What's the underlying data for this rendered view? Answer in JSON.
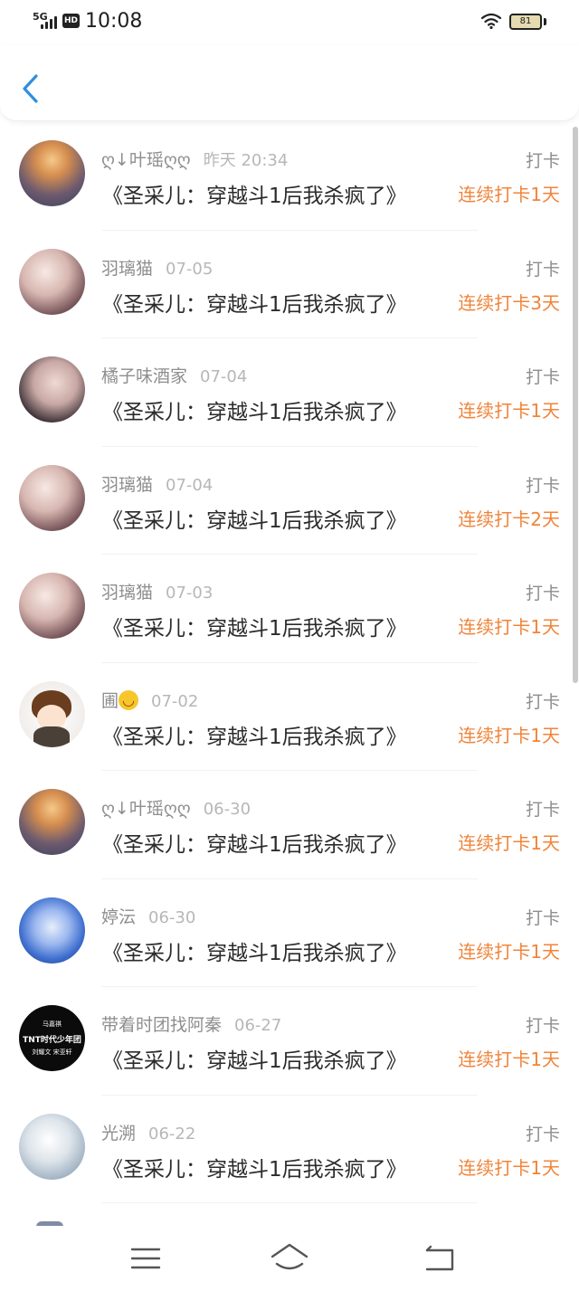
{
  "status_bar": {
    "network": "5G",
    "hd_badge": "HD",
    "time": "10:08",
    "battery": "81"
  },
  "header": {
    "back_icon": "chevron-left-icon"
  },
  "items": [
    {
      "user": "ღ↓叶瑶ღღ",
      "time": "昨天 20:34",
      "title": "《圣采儿：穿越斗1后我杀疯了》",
      "label": "打卡",
      "streak": "连续打卡1天"
    },
    {
      "user": "羽璃猫",
      "time": "07-05",
      "title": "《圣采儿：穿越斗1后我杀疯了》",
      "label": "打卡",
      "streak": "连续打卡3天"
    },
    {
      "user": "橘子味酒家",
      "time": "07-04",
      "title": "《圣采儿：穿越斗1后我杀疯了》",
      "label": "打卡",
      "streak": "连续打卡1天"
    },
    {
      "user": "羽璃猫",
      "time": "07-04",
      "title": "《圣采儿：穿越斗1后我杀疯了》",
      "label": "打卡",
      "streak": "连续打卡2天"
    },
    {
      "user": "羽璃猫",
      "time": "07-03",
      "title": "《圣采儿：穿越斗1后我杀疯了》",
      "label": "打卡",
      "streak": "连续打卡1天"
    },
    {
      "user": "圃",
      "time": "07-02",
      "title": "《圣采儿：穿越斗1后我杀疯了》",
      "label": "打卡",
      "streak": "连续打卡1天"
    },
    {
      "user": "ღ↓叶瑶ღღ",
      "time": "06-30",
      "title": "《圣采儿：穿越斗1后我杀疯了》",
      "label": "打卡",
      "streak": "连续打卡1天"
    },
    {
      "user": "婷沄",
      "time": "06-30",
      "title": "《圣采儿：穿越斗1后我杀疯了》",
      "label": "打卡",
      "streak": "连续打卡1天"
    },
    {
      "user": "带着时团找阿秦",
      "time": "06-27",
      "title": "《圣采儿：穿越斗1后我杀疯了》",
      "label": "打卡",
      "streak": "连续打卡1天"
    },
    {
      "user": "光溯",
      "time": "06-22",
      "title": "《圣采儿：穿越斗1后我杀疯了》",
      "label": "打卡",
      "streak": "连续打卡1天"
    }
  ],
  "avatar_text": {
    "line1": "马嘉祺",
    "line2": "TNT时代少年团",
    "line3": "刘耀文 宋亚轩"
  },
  "nav": {
    "menu_icon": "menu-icon",
    "home_icon": "home-icon",
    "back_icon": "back-icon"
  },
  "colors": {
    "accent_blue": "#2f8fe0",
    "streak_orange": "#f0843a"
  }
}
